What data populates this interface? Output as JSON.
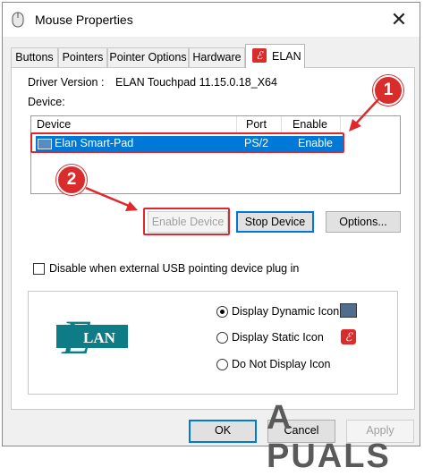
{
  "window": {
    "title": "Mouse Properties",
    "close_glyph": "✕"
  },
  "tabs": [
    {
      "label": "Buttons",
      "active": false
    },
    {
      "label": "Pointers",
      "active": false
    },
    {
      "label": "Pointer Options",
      "active": false
    },
    {
      "label": "Hardware",
      "active": false
    },
    {
      "label": "ELAN",
      "active": true
    }
  ],
  "elan_panel": {
    "driver_label": "Driver Version :",
    "driver_value": "ELAN Touchpad 11.15.0.18_X64",
    "device_label": "Device:",
    "list_headers": {
      "device": "Device",
      "port": "Port",
      "enable": "Enable"
    },
    "devices": [
      {
        "name": "Elan Smart-Pad",
        "port": "PS/2",
        "enable": "Enable",
        "selected": true
      }
    ],
    "buttons": {
      "enable_device": "Enable Device",
      "stop_device": "Stop Device",
      "options": "Options..."
    },
    "disable_usb_label": "Disable when external USB pointing device plug in",
    "icon_options": [
      {
        "label": "Display Dynamic Icon",
        "selected": true
      },
      {
        "label": "Display Static Icon",
        "selected": false
      },
      {
        "label": "Do Not Display Icon",
        "selected": false
      }
    ],
    "logo_text": "LAN",
    "logo_letter": "E"
  },
  "footer": {
    "ok": "OK",
    "cancel": "Cancel",
    "apply": "Apply"
  },
  "annotations": {
    "badge1": "1",
    "badge2": "2"
  },
  "watermark": "A  PUALS",
  "colors": {
    "highlight": "#0078d7",
    "annotation_red": "#e0272b",
    "logo_teal": "#0e7c86"
  }
}
